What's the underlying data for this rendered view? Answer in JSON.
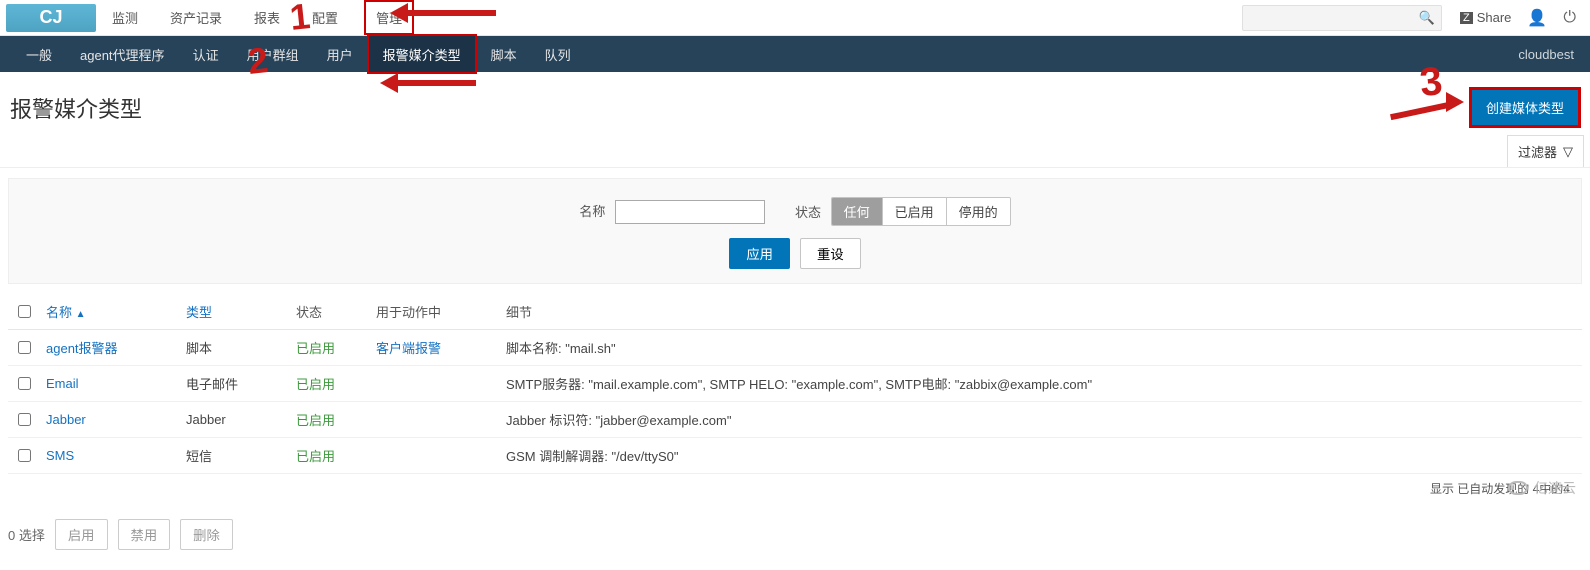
{
  "topnav": {
    "logo_text": "CJ",
    "items": [
      "监测",
      "资产记录",
      "报表",
      "配置",
      "管理"
    ],
    "active_index": 4,
    "share_label": "Share"
  },
  "subnav": {
    "items": [
      "一般",
      "agent代理程序",
      "认证",
      "用户群组",
      "用户",
      "报警媒介类型",
      "脚本",
      "队列"
    ],
    "active_index": 5,
    "right_label": "cloudbest"
  },
  "page": {
    "title": "报警媒介类型",
    "create_btn": "创建媒体类型",
    "filter_tab": "过滤器"
  },
  "filter": {
    "name_label": "名称",
    "name_value": "",
    "status_label": "状态",
    "status_options": [
      "任何",
      "已启用",
      "停用的"
    ],
    "status_active": 0,
    "apply_btn": "应用",
    "reset_btn": "重设"
  },
  "table": {
    "columns": [
      "名称",
      "类型",
      "状态",
      "用于动作中",
      "细节"
    ],
    "rows": [
      {
        "name": "agent报警器",
        "type": "脚本",
        "status": "已启用",
        "used_in": "客户端报警",
        "detail": "脚本名称: \"mail.sh\""
      },
      {
        "name": "Email",
        "type": "电子邮件",
        "status": "已启用",
        "used_in": "",
        "detail": "SMTP服务器: \"mail.example.com\", SMTP HELO: \"example.com\", SMTP电邮: \"zabbix@example.com\""
      },
      {
        "name": "Jabber",
        "type": "Jabber",
        "status": "已启用",
        "used_in": "",
        "detail": "Jabber 标识符: \"jabber@example.com\""
      },
      {
        "name": "SMS",
        "type": "短信",
        "status": "已启用",
        "used_in": "",
        "detail": "GSM 调制解调器: \"/dev/ttyS0\""
      }
    ],
    "footer": "显示 已自动发现的 4中的4"
  },
  "bulk": {
    "count_label": "0 选择",
    "enable_btn": "启用",
    "disable_btn": "禁用",
    "delete_btn": "删除"
  },
  "annotations": {
    "d1": "1",
    "d2": "2",
    "d3": "3"
  },
  "watermark": "亿速云"
}
